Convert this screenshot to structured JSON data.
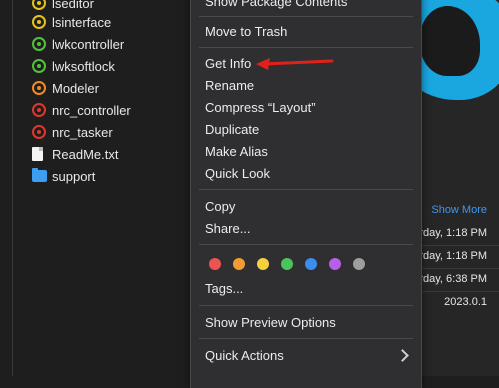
{
  "files": [
    {
      "name": "lseditor",
      "icon": "gear-icon",
      "color": "yellow"
    },
    {
      "name": "lsinterface",
      "icon": "gear-icon",
      "color": "yellow"
    },
    {
      "name": "lwkcontroller",
      "icon": "gear-icon",
      "color": "green"
    },
    {
      "name": "lwksoftlock",
      "icon": "gear-icon",
      "color": "green"
    },
    {
      "name": "Modeler",
      "icon": "gear-icon",
      "color": "orange"
    },
    {
      "name": "nrc_controller",
      "icon": "gear-icon",
      "color": "red"
    },
    {
      "name": "nrc_tasker",
      "icon": "gear-icon",
      "color": "red"
    },
    {
      "name": "ReadMe.txt",
      "icon": "document-icon",
      "color": "white"
    },
    {
      "name": "support",
      "icon": "folder-icon",
      "color": "#3d9df0"
    }
  ],
  "context_menu": {
    "show_package_contents": "Show Package Contents",
    "move_to_trash": "Move to Trash",
    "get_info": "Get Info",
    "rename": "Rename",
    "compress": "Compress “Layout”",
    "duplicate": "Duplicate",
    "make_alias": "Make Alias",
    "quick_look": "Quick Look",
    "copy": "Copy",
    "share": "Share...",
    "tags": "Tags...",
    "show_preview_options": "Show Preview Options",
    "quick_actions": "Quick Actions",
    "tag_colors": [
      "#ef5350",
      "#f39c33",
      "#f4d03f",
      "#4cc35a",
      "#3b8ef0",
      "#b561e6",
      "#9e9e9e"
    ]
  },
  "info_panel": {
    "show_more": "Show More",
    "rows": [
      "rday, 1:18 PM",
      "rday, 1:18 PM",
      "rday, 6:38 PM",
      "2023.0.1"
    ]
  },
  "colors": {
    "annotation_arrow": "#e0211b",
    "accent": "#3d97f0"
  }
}
